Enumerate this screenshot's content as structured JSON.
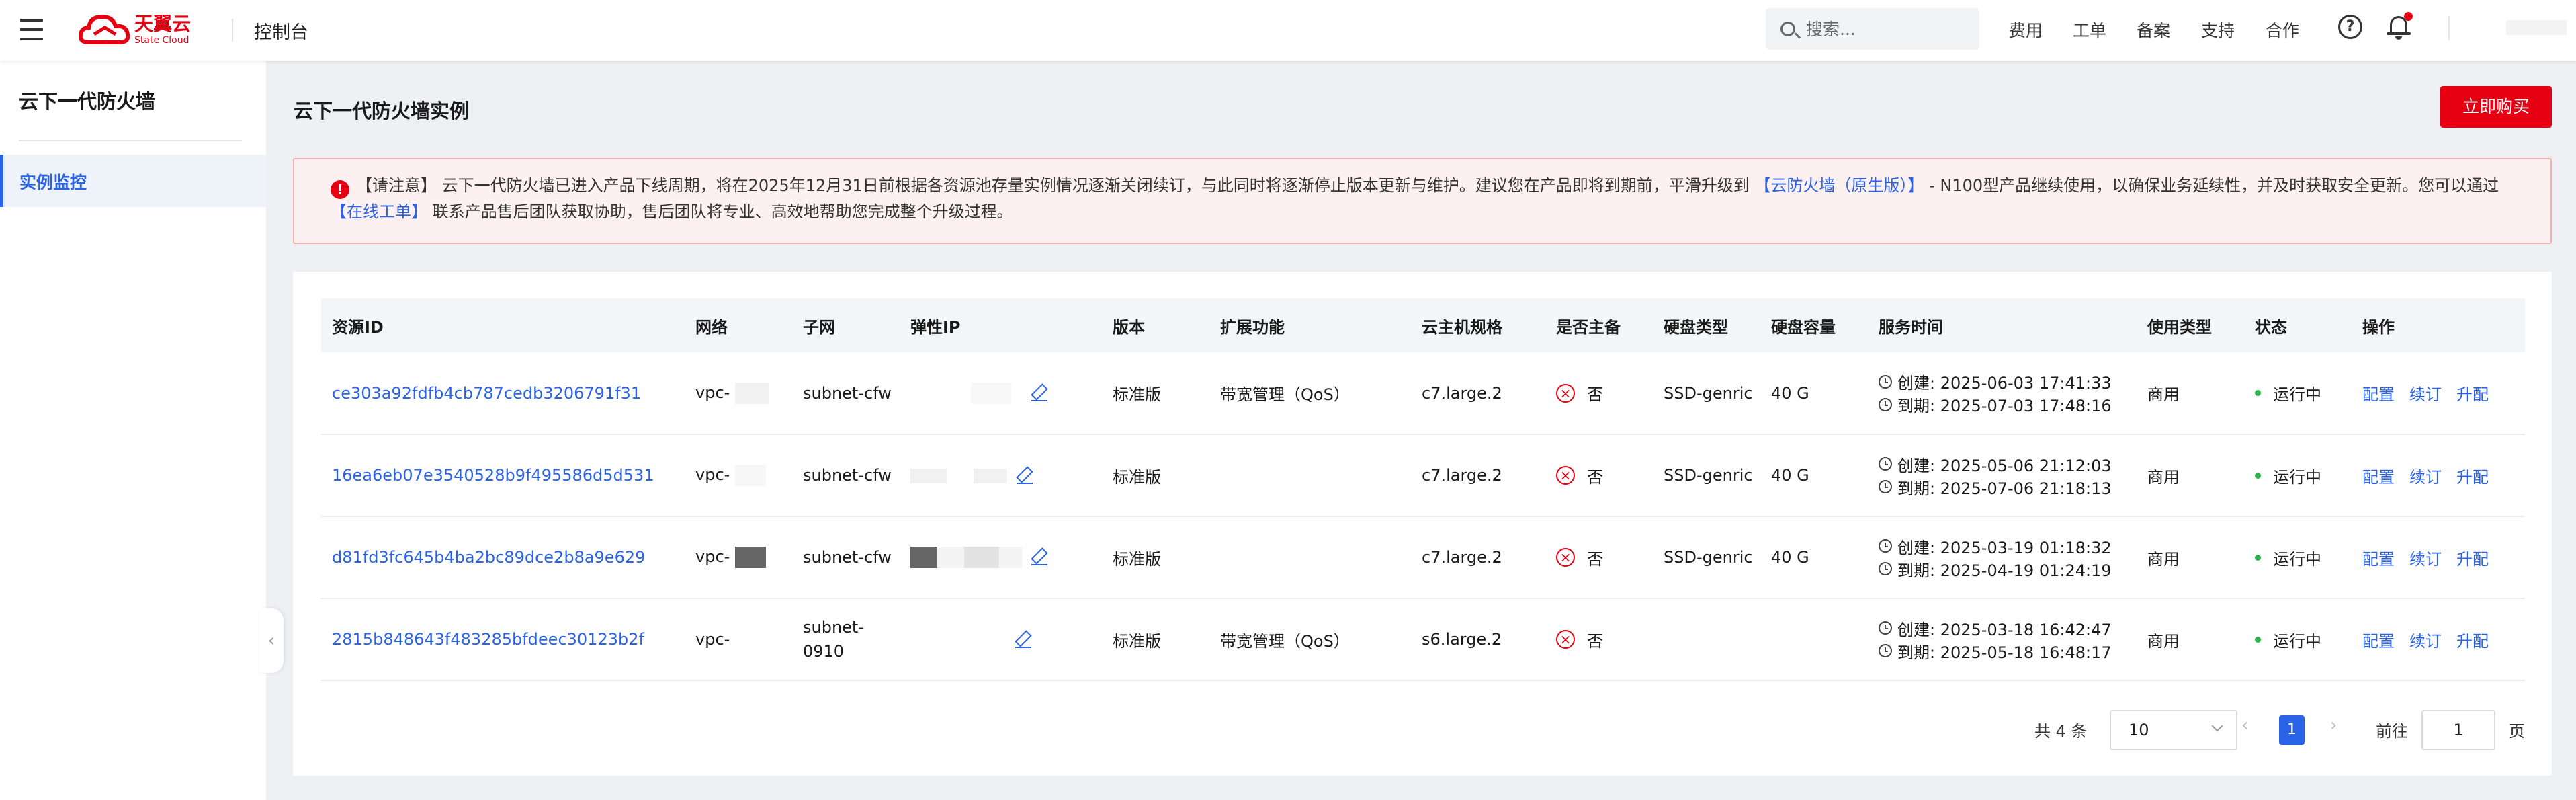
{
  "topbar": {
    "logo_cn": "天翼云",
    "logo_en": "State Cloud",
    "console": "控制台",
    "search_placeholder": "搜索...",
    "links": [
      "费用",
      "工单",
      "备案",
      "支持",
      "合作"
    ],
    "help_glyph": "?"
  },
  "sidebar": {
    "title": "云下一代防火墙",
    "items": [
      {
        "label": "实例监控",
        "active": true
      }
    ]
  },
  "main": {
    "title": "云下一代防火墙实例",
    "buy_button": "立即购买",
    "notice": {
      "line1_a": "【请注意】 云下一代防火墙已进入产品下线周期，将在2025年12月31日前根据各资源池存量实例情况逐渐关闭续订，与此同时将逐渐停止版本更新与维护。建议您在产品即将到期前，平滑升级到 ",
      "link1": "【云防火墙（原生版）】",
      "line1_b": " - N100型产品继续使用，以确保业务延续性，并及时获取安全更新。您可以通过",
      "link2": "【在线工单】",
      "line2": " 联系产品售后团队获取协助，售后团队将专业、高效地帮助您完成整个升级过程。"
    }
  },
  "table": {
    "headers": [
      "资源ID",
      "网络",
      "子网",
      "弹性IP",
      "版本",
      "扩展功能",
      "云主机规格",
      "是否主备",
      "硬盘类型",
      "硬盘容量",
      "服务时间",
      "使用类型",
      "状态",
      "操作"
    ],
    "rows": [
      {
        "id": "ce303a92fdfb4cb787cedb3206791f31",
        "vpc": "vpc-",
        "subnet": "subnet-cfw",
        "version": "标准版",
        "ext": "带宽管理（QoS）",
        "spec": "c7.large.2",
        "ha": "否",
        "disk_type": "SSD-genric",
        "disk_size": "40 G",
        "created": "创建: 2025-06-03 17:41:33",
        "expire": "到期: 2025-07-03 17:48:16",
        "usage": "商用",
        "status": "运行中",
        "ops": [
          "配置",
          "续订",
          "升配"
        ]
      },
      {
        "id": "16ea6eb07e3540528b9f495586d5d531",
        "vpc": "vpc-",
        "subnet": "subnet-cfw",
        "version": "标准版",
        "ext": "",
        "spec": "c7.large.2",
        "ha": "否",
        "disk_type": "SSD-genric",
        "disk_size": "40 G",
        "created": "创建: 2025-05-06 21:12:03",
        "expire": "到期: 2025-07-06 21:18:13",
        "usage": "商用",
        "status": "运行中",
        "ops": [
          "配置",
          "续订",
          "升配"
        ]
      },
      {
        "id": "d81fd3fc645b4ba2bc89dce2b8a9e629",
        "vpc": "vpc-",
        "subnet": "subnet-cfw",
        "version": "标准版",
        "ext": "",
        "spec": "c7.large.2",
        "ha": "否",
        "disk_type": "SSD-genric",
        "disk_size": "40 G",
        "created": "创建: 2025-03-19 01:18:32",
        "expire": "到期: 2025-04-19 01:24:19",
        "usage": "商用",
        "status": "运行中",
        "ops": [
          "配置",
          "续订",
          "升配"
        ]
      },
      {
        "id": "2815b848643f483285bfdeec30123b2f",
        "vpc": "vpc-",
        "subnet": "subnet-0910",
        "version": "标准版",
        "ext": "带宽管理（QoS）",
        "spec": "s6.large.2",
        "ha": "否",
        "disk_type": "",
        "disk_size": "",
        "created": "创建: 2025-03-18 16:42:47",
        "expire": "到期: 2025-05-18 16:48:17",
        "usage": "商用",
        "status": "运行中",
        "ops": [
          "配置",
          "续订",
          "升配"
        ]
      }
    ]
  },
  "pagination": {
    "total": "共 4 条",
    "page_size": "10",
    "current": "1",
    "goto_label": "前往",
    "goto_value": "1",
    "page_unit": "页"
  },
  "colors": {
    "brand": "#e60012",
    "link": "#2b63e8",
    "running": "#2bb34a"
  }
}
